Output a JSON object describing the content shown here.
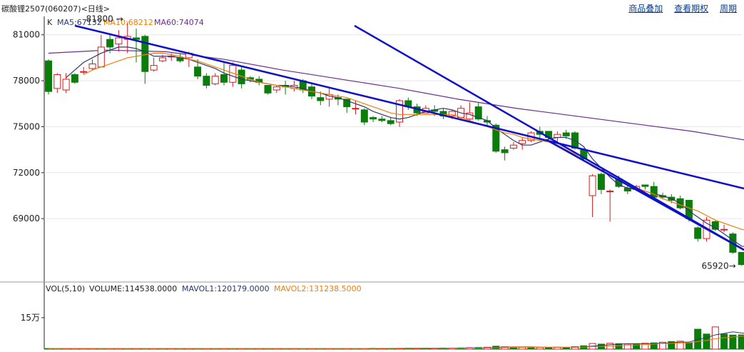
{
  "header": {
    "title": "碳酸锂2507",
    "code": "(060207)",
    "period": "<日线>",
    "links": [
      "商品叠加",
      "查看期权",
      "周期"
    ]
  },
  "colors": {
    "up": "#e0191f",
    "down": "#0b7d0b",
    "ma5": "#2a3a6e",
    "ma10": "#f07f0a",
    "ma60": "#6b2d8f",
    "trendline": "#1010c8",
    "grid": "#e6e6e6",
    "axis": "#222222"
  },
  "chart_data": {
    "type": "candlestick",
    "price_legend": {
      "k": "K",
      "ma5": "MA5:67132",
      "ma10": "MA10:68212",
      "ma60": "MA60:74074"
    },
    "volume_legend": {
      "vol": "VOL(5,10)",
      "volume": "VOLUME:114538.0000",
      "mavol1": "MAVOL1:120179.0000",
      "mavol2": "MAVOL2:131238.5000"
    },
    "price_ticks": [
      "81000",
      "78000",
      "75000",
      "72000",
      "69000"
    ],
    "price_tick_values": [
      81000,
      78000,
      75000,
      72000,
      69000
    ],
    "volume_ticks": [
      "15万"
    ],
    "volume_tick_values": [
      150000
    ],
    "ylim": [
      65000,
      82200
    ],
    "vol_ylim": [
      0,
      245000
    ],
    "annotations": {
      "high": "81800",
      "low": "65920"
    },
    "high_value": 81800,
    "low_value": 65920,
    "candles": [
      [
        79300,
        77300,
        77100,
        79400
      ],
      [
        77500,
        78400,
        77200,
        78500
      ],
      [
        77400,
        78100,
        77200,
        78500
      ],
      [
        78400,
        77900,
        77800,
        78500
      ],
      [
        78600,
        78600,
        78400,
        78900
      ],
      [
        78800,
        79100,
        78700,
        79400
      ],
      [
        78900,
        80200,
        78900,
        81000
      ],
      [
        80700,
        80200,
        79800,
        81100
      ],
      [
        80400,
        80800,
        79900,
        81300
      ],
      [
        80700,
        80900,
        79800,
        81800
      ],
      [
        80800,
        80700,
        79200,
        81400
      ],
      [
        80900,
        78600,
        77800,
        81000
      ],
      [
        78700,
        79000,
        78600,
        79500
      ],
      [
        79300,
        79500,
        79200,
        79700
      ],
      [
        79600,
        79600,
        79300,
        79800
      ],
      [
        79500,
        79300,
        79200,
        79800
      ],
      [
        79500,
        79800,
        78900,
        79900
      ],
      [
        78900,
        78300,
        78100,
        79400
      ],
      [
        78300,
        77700,
        77500,
        78500
      ],
      [
        77800,
        78300,
        77700,
        78500
      ],
      [
        78400,
        77900,
        77700,
        79200
      ],
      [
        77900,
        79000,
        77600,
        79200
      ],
      [
        78700,
        77800,
        77500,
        78900
      ],
      [
        78200,
        78100,
        77900,
        78300
      ],
      [
        78100,
        77900,
        77700,
        78300
      ],
      [
        77700,
        77200,
        77100,
        77700
      ],
      [
        77400,
        77600,
        77200,
        77700
      ],
      [
        77700,
        77600,
        77100,
        78000
      ],
      [
        77500,
        77700,
        77300,
        78000
      ],
      [
        78000,
        77400,
        77200,
        78100
      ],
      [
        77600,
        77000,
        76800,
        77900
      ],
      [
        76900,
        76700,
        76400,
        77300
      ],
      [
        76800,
        77100,
        76300,
        77600
      ],
      [
        76900,
        76800,
        76400,
        77100
      ],
      [
        76800,
        76300,
        75900,
        76800
      ],
      [
        76200,
        76200,
        75800,
        76700
      ],
      [
        76100,
        75300,
        75100,
        76200
      ],
      [
        75600,
        75500,
        75300,
        75700
      ],
      [
        75500,
        75400,
        75300,
        75700
      ],
      [
        75400,
        75200,
        75100,
        75600
      ],
      [
        75300,
        76700,
        75000,
        76800
      ],
      [
        76700,
        76300,
        76100,
        76900
      ],
      [
        76300,
        75900,
        75700,
        76500
      ],
      [
        75900,
        76200,
        75900,
        76400
      ],
      [
        76100,
        76000,
        75700,
        76400
      ],
      [
        76000,
        75700,
        75500,
        76200
      ],
      [
        75700,
        76000,
        75500,
        76100
      ],
      [
        75600,
        76200,
        75400,
        76400
      ],
      [
        75500,
        75900,
        75400,
        76600
      ],
      [
        76300,
        75500,
        75400,
        76600
      ],
      [
        75400,
        75300,
        75000,
        75700
      ],
      [
        75100,
        73400,
        73300,
        75200
      ],
      [
        73500,
        73300,
        72800,
        73700
      ],
      [
        73600,
        73800,
        73500,
        74000
      ],
      [
        73900,
        74100,
        73500,
        74300
      ],
      [
        74100,
        74600,
        74000,
        74700
      ],
      [
        74700,
        74500,
        74100,
        75000
      ],
      [
        74700,
        74300,
        74000,
        74600
      ],
      [
        74300,
        74500,
        73900,
        74700
      ],
      [
        74600,
        74400,
        74200,
        74800
      ],
      [
        74600,
        73600,
        73500,
        74700
      ],
      [
        73500,
        72900,
        72800,
        73600
      ],
      [
        70500,
        71800,
        69100,
        71900
      ],
      [
        71900,
        70900,
        70600,
        72000
      ],
      [
        70800,
        70800,
        68800,
        70900
      ],
      [
        71600,
        71100,
        71000,
        71800
      ],
      [
        71000,
        70800,
        70600,
        71200
      ],
      [
        70900,
        71100,
        70800,
        71200
      ],
      [
        71200,
        71100,
        70900,
        71200
      ],
      [
        71100,
        70400,
        70300,
        71400
      ],
      [
        70500,
        70400,
        70300,
        70700
      ],
      [
        70400,
        70200,
        70000,
        70600
      ],
      [
        70300,
        69700,
        69600,
        70500
      ],
      [
        70200,
        69000,
        68800,
        70200
      ],
      [
        68400,
        67700,
        67500,
        68500
      ],
      [
        67700,
        68900,
        67500,
        69100
      ],
      [
        68800,
        68300,
        68200,
        68900
      ],
      [
        68300,
        68300,
        68100,
        68600
      ],
      [
        68000,
        66800,
        66700,
        68100
      ],
      [
        66800,
        66000,
        65920,
        66800
      ],
      [
        66000,
        66100,
        65920,
        66300
      ]
    ],
    "volumes": [
      [
        3000,
        0
      ],
      [
        3000,
        0
      ],
      [
        3000,
        1
      ],
      [
        3000,
        1
      ],
      [
        3000,
        1
      ],
      [
        3000,
        1
      ],
      [
        3000,
        0
      ],
      [
        3000,
        1
      ],
      [
        3000,
        1
      ],
      [
        3000,
        0
      ],
      [
        3000,
        1
      ],
      [
        3000,
        0
      ],
      [
        3000,
        1
      ],
      [
        3000,
        0
      ],
      [
        3000,
        1
      ],
      [
        3000,
        0
      ],
      [
        3000,
        1
      ],
      [
        3000,
        0
      ],
      [
        3000,
        1
      ],
      [
        3000,
        0
      ],
      [
        3000,
        1
      ],
      [
        3000,
        0
      ],
      [
        3000,
        1
      ],
      [
        3000,
        0
      ],
      [
        3000,
        1
      ],
      [
        3000,
        0
      ],
      [
        3000,
        1
      ],
      [
        3000,
        0
      ],
      [
        3000,
        1
      ],
      [
        3000,
        0
      ],
      [
        3000,
        1
      ],
      [
        3000,
        0
      ],
      [
        3000,
        1
      ],
      [
        3000,
        0
      ],
      [
        3000,
        1
      ],
      [
        3000,
        0
      ],
      [
        3000,
        1
      ],
      [
        4000,
        0
      ],
      [
        4000,
        1
      ],
      [
        4000,
        0
      ],
      [
        4000,
        1
      ],
      [
        4500,
        0
      ],
      [
        4500,
        1
      ],
      [
        5000,
        0
      ],
      [
        5000,
        1
      ],
      [
        5500,
        0
      ],
      [
        5500,
        1
      ],
      [
        6000,
        0
      ],
      [
        7000,
        1
      ],
      [
        8000,
        0
      ],
      [
        9000,
        1
      ],
      [
        14000,
        0
      ],
      [
        11000,
        1
      ],
      [
        9000,
        0
      ],
      [
        9000,
        1
      ],
      [
        10000,
        0
      ],
      [
        8000,
        1
      ],
      [
        8000,
        0
      ],
      [
        9000,
        1
      ],
      [
        8000,
        0
      ],
      [
        12000,
        1
      ],
      [
        16000,
        0
      ],
      [
        27000,
        1
      ],
      [
        24000,
        0
      ],
      [
        28000,
        1
      ],
      [
        26000,
        0
      ],
      [
        24000,
        1
      ],
      [
        26000,
        0
      ],
      [
        28000,
        1
      ],
      [
        30000,
        0
      ],
      [
        33000,
        1
      ],
      [
        36000,
        0
      ],
      [
        38000,
        1
      ],
      [
        30000,
        0
      ],
      [
        95000,
        0
      ],
      [
        72000,
        0
      ],
      [
        106000,
        1
      ],
      [
        72000,
        0
      ],
      [
        67000,
        0
      ],
      [
        68000,
        0
      ],
      [
        62000,
        0
      ]
    ],
    "ma5": [
      78200,
      78700,
      79200,
      79500,
      79800,
      80000,
      80200,
      80200,
      80100,
      79900,
      79600,
      79600,
      79600,
      79500,
      79400,
      79200,
      79000,
      78800,
      78500,
      78300,
      78100,
      78000,
      77900,
      77800,
      77700,
      77700,
      77600,
      77500,
      77300,
      77200,
      77000,
      76900,
      76700,
      76500,
      76300,
      76000,
      75800,
      75600,
      75500,
      75600,
      75800,
      76000,
      76100,
      76200,
      76100,
      75900,
      75800,
      75600,
      75400,
      74900,
      74500,
      74100,
      73800,
      73800,
      74000,
      74200,
      74300,
      74300,
      74100,
      73700,
      72900,
      72300,
      71700,
      71200,
      71000,
      70900,
      70800,
      70600,
      70500,
      70300,
      70000,
      69500,
      69100,
      68700,
      68400,
      68000,
      67600,
      67200,
      67132
    ],
    "ma10": [
      78400,
      78700,
      78900,
      79100,
      79300,
      79500,
      79600,
      79700,
      79800,
      79800,
      79700,
      79600,
      79400,
      79300,
      79100,
      78900,
      78700,
      78500,
      78300,
      78100,
      77900,
      77800,
      77700,
      77600,
      77500,
      77400,
      77300,
      77200,
      77100,
      77000,
      76900,
      76700,
      76500,
      76300,
      76100,
      75900,
      75800,
      75800,
      75800,
      75800,
      75800,
      75800,
      75800,
      75600,
      75400,
      75200,
      75000,
      74800,
      74600,
      74500,
      74300,
      74200,
      74100,
      74000,
      73800,
      73500,
      73200,
      72800,
      72400,
      72100,
      71800,
      71500,
      71300,
      71000,
      70800,
      70600,
      70300,
      70100,
      69900,
      69700,
      69500,
      69200,
      68900,
      68700,
      68500,
      68300,
      68212
    ],
    "ma60": [
      [
        0,
        79800
      ],
      [
        10,
        80000
      ],
      [
        20,
        79900
      ],
      [
        30,
        79400
      ],
      [
        40,
        78700
      ],
      [
        50,
        78100
      ],
      [
        60,
        77500
      ],
      [
        70,
        76800
      ],
      [
        80,
        76200
      ],
      [
        90,
        75700
      ],
      [
        100,
        75200
      ],
      [
        110,
        74700
      ],
      [
        120,
        74074
      ]
    ],
    "ma60_offset": 2,
    "trendlines": [
      [
        [
          0,
          81800
        ],
        [
          80,
          72500
        ]
      ],
      [
        [
          0,
          81700
        ],
        [
          77,
          74500
        ]
      ],
      [
        [
          39,
          74500
        ],
        [
          80,
          69200
        ]
      ]
    ],
    "grid": true
  }
}
